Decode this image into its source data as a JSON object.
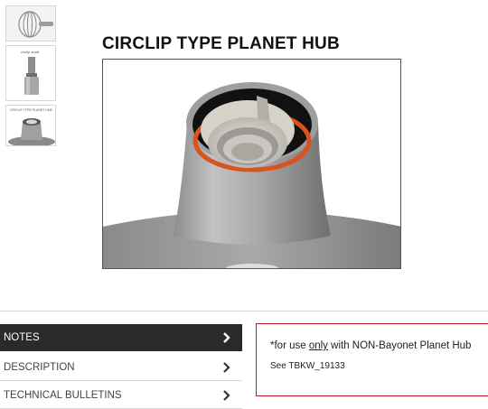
{
  "product": {
    "title": "CIRCLIP TYPE PLANET HUB"
  },
  "thumbnails": [
    {
      "name": "whisk",
      "caption": ""
    },
    {
      "name": "circlip shaft",
      "caption": "circlip shaft"
    },
    {
      "name": "circlip type planet hub",
      "caption": "CIRCLIP TYPE PLANET HUB"
    }
  ],
  "tabs": [
    {
      "label": "NOTES",
      "active": true,
      "icon": "chevron-right-icon"
    },
    {
      "label": "DESCRIPTION",
      "active": false,
      "icon": "chevron-right-icon"
    },
    {
      "label": "TECHNICAL BULLETINS",
      "active": false,
      "icon": "chevron-right-icon"
    }
  ],
  "notes": {
    "prefix": "*for use ",
    "emphasis": "only",
    "suffix": " with NON-Bayonet Planet Hub",
    "reference": "See TBKW_19133"
  },
  "colors": {
    "active_tab_bg": "#2a2a2a",
    "notes_border": "#c8102e",
    "hub_gray": "#9a9a9a",
    "o_ring": "#d9531e"
  }
}
